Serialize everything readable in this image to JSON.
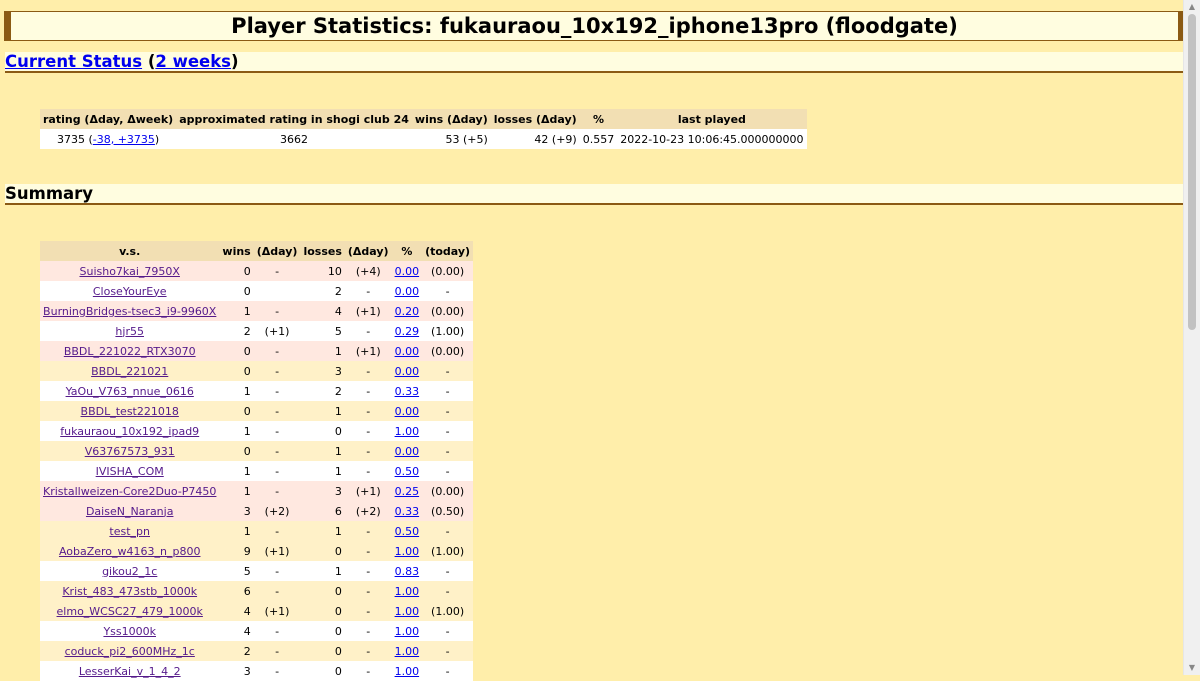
{
  "title": "Player Statistics: fukauraou_10x192_iphone13pro (floodgate)",
  "current": {
    "link_current": "Current Status",
    "paren_open": "(",
    "link_weeks": "2 weeks",
    "paren_close": ")",
    "headers": [
      "rating (Δday, Δweek)",
      "approximated rating in shogi club 24",
      "wins (Δday)",
      "losses (Δday)",
      "%",
      "last played"
    ],
    "rating": "3735 (",
    "rating_delta": "-38, +3735",
    "rating_close": ")",
    "approx": "3662",
    "wins": "53 (+5)",
    "losses": "42 (+9)",
    "pct": "0.557",
    "last": "2022-10-23 10:06:45.000000000"
  },
  "summary": {
    "heading": "Summary",
    "headers": [
      "v.s.",
      "wins",
      "(Δday)",
      "losses",
      "(Δday)",
      "%",
      "(today)"
    ],
    "rows": [
      {
        "vs": "Suisho7kai_7950X",
        "w": "0",
        "wd": "-",
        "l": "10",
        "ld": "(+4)",
        "p": "0.00",
        "t": "(0.00)",
        "c": "pink"
      },
      {
        "vs": "CloseYourEye",
        "w": "0",
        "wd": "",
        "l": "2",
        "ld": "-",
        "p": "0.00",
        "t": "-",
        "c": "white"
      },
      {
        "vs": "BurningBridges-tsec3_i9-9960X",
        "w": "1",
        "wd": "-",
        "l": "4",
        "ld": "(+1)",
        "p": "0.20",
        "t": "(0.00)",
        "c": "pink"
      },
      {
        "vs": "hjr55",
        "w": "2",
        "wd": "(+1)",
        "l": "5",
        "ld": "-",
        "p": "0.29",
        "t": "(1.00)",
        "c": "white"
      },
      {
        "vs": "BBDL_221022_RTX3070",
        "w": "0",
        "wd": "-",
        "l": "1",
        "ld": "(+1)",
        "p": "0.00",
        "t": "(0.00)",
        "c": "pink"
      },
      {
        "vs": "BBDL_221021",
        "w": "0",
        "wd": "-",
        "l": "3",
        "ld": "-",
        "p": "0.00",
        "t": "-",
        "c": "tan"
      },
      {
        "vs": "YaOu_V763_nnue_0616",
        "w": "1",
        "wd": "-",
        "l": "2",
        "ld": "-",
        "p": "0.33",
        "t": "-",
        "c": "white"
      },
      {
        "vs": "BBDL_test221018",
        "w": "0",
        "wd": "-",
        "l": "1",
        "ld": "-",
        "p": "0.00",
        "t": "-",
        "c": "tan"
      },
      {
        "vs": "fukauraou_10x192_ipad9",
        "w": "1",
        "wd": "-",
        "l": "0",
        "ld": "-",
        "p": "1.00",
        "t": "-",
        "c": "white"
      },
      {
        "vs": "V63767573_931",
        "w": "0",
        "wd": "-",
        "l": "1",
        "ld": "-",
        "p": "0.00",
        "t": "-",
        "c": "tan"
      },
      {
        "vs": "IVISHA_COM",
        "w": "1",
        "wd": "-",
        "l": "1",
        "ld": "-",
        "p": "0.50",
        "t": "-",
        "c": "white"
      },
      {
        "vs": "Kristallweizen-Core2Duo-P7450",
        "w": "1",
        "wd": "-",
        "l": "3",
        "ld": "(+1)",
        "p": "0.25",
        "t": "(0.00)",
        "c": "pink"
      },
      {
        "vs": "DaiseN_Naranja",
        "w": "3",
        "wd": "(+2)",
        "l": "6",
        "ld": "(+2)",
        "p": "0.33",
        "t": "(0.50)",
        "c": "pink"
      },
      {
        "vs": "test_pn",
        "w": "1",
        "wd": "-",
        "l": "1",
        "ld": "-",
        "p": "0.50",
        "t": "-",
        "c": "tan"
      },
      {
        "vs": "AobaZero_w4163_n_p800",
        "w": "9",
        "wd": "(+1)",
        "l": "0",
        "ld": "-",
        "p": "1.00",
        "t": "(1.00)",
        "c": "tan"
      },
      {
        "vs": "gikou2_1c",
        "w": "5",
        "wd": "-",
        "l": "1",
        "ld": "-",
        "p": "0.83",
        "t": "-",
        "c": "white"
      },
      {
        "vs": "Krist_483_473stb_1000k",
        "w": "6",
        "wd": "-",
        "l": "0",
        "ld": "-",
        "p": "1.00",
        "t": "-",
        "c": "tan"
      },
      {
        "vs": "elmo_WCSC27_479_1000k",
        "w": "4",
        "wd": "(+1)",
        "l": "0",
        "ld": "-",
        "p": "1.00",
        "t": "(1.00)",
        "c": "tan"
      },
      {
        "vs": "Yss1000k",
        "w": "4",
        "wd": "-",
        "l": "0",
        "ld": "-",
        "p": "1.00",
        "t": "-",
        "c": "white"
      },
      {
        "vs": "coduck_pi2_600MHz_1c",
        "w": "2",
        "wd": "-",
        "l": "0",
        "ld": "-",
        "p": "1.00",
        "t": "-",
        "c": "tan"
      },
      {
        "vs": "LesserKai_v_1_4_2",
        "w": "3",
        "wd": "-",
        "l": "0",
        "ld": "-",
        "p": "1.00",
        "t": "-",
        "c": "white"
      }
    ]
  }
}
